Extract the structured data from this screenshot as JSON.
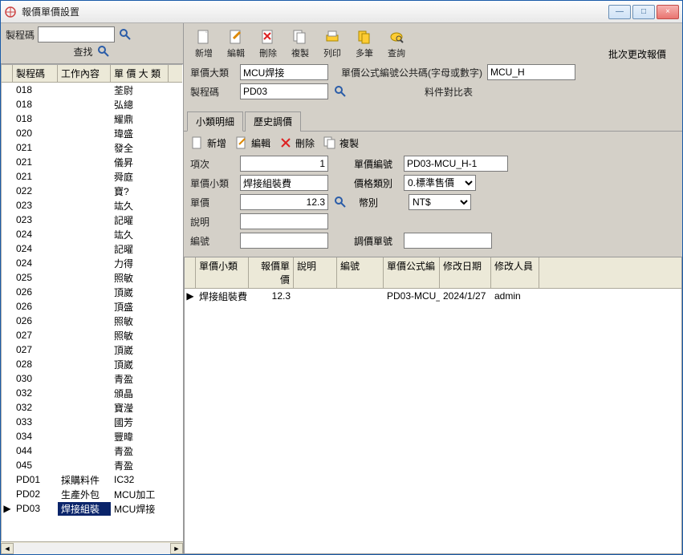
{
  "window": {
    "title": "報價單價設置"
  },
  "winbtns": {
    "min": "—",
    "max": "□",
    "close": "×"
  },
  "leftSearch": {
    "codeLabel": "製程碼",
    "codeValue": "",
    "findLabel": "查找"
  },
  "leftGrid": {
    "headers": {
      "code": "製程碼",
      "work": "工作內容",
      "cat": "單 價 大 類"
    },
    "rows": [
      {
        "code": "018",
        "work": "",
        "cat": "荃尉"
      },
      {
        "code": "018",
        "work": "",
        "cat": "弘總"
      },
      {
        "code": "018",
        "work": "",
        "cat": "耀鼎"
      },
      {
        "code": "020",
        "work": "",
        "cat": "瑋盛"
      },
      {
        "code": "021",
        "work": "",
        "cat": "發全"
      },
      {
        "code": "021",
        "work": "",
        "cat": "儀昇"
      },
      {
        "code": "021",
        "work": "",
        "cat": "舜庭"
      },
      {
        "code": "022",
        "work": "",
        "cat": "寶?"
      },
      {
        "code": "023",
        "work": "",
        "cat": "竑久"
      },
      {
        "code": "023",
        "work": "",
        "cat": "記曜"
      },
      {
        "code": "024",
        "work": "",
        "cat": "竑久"
      },
      {
        "code": "024",
        "work": "",
        "cat": "記曜"
      },
      {
        "code": "024",
        "work": "",
        "cat": "力得"
      },
      {
        "code": "025",
        "work": "",
        "cat": "照敏"
      },
      {
        "code": "026",
        "work": "",
        "cat": "頂崴"
      },
      {
        "code": "026",
        "work": "",
        "cat": "頂盛"
      },
      {
        "code": "026",
        "work": "",
        "cat": "照敏"
      },
      {
        "code": "027",
        "work": "",
        "cat": "照敏"
      },
      {
        "code": "027",
        "work": "",
        "cat": "頂崴"
      },
      {
        "code": "028",
        "work": "",
        "cat": "頂崴"
      },
      {
        "code": "030",
        "work": "",
        "cat": "青盈"
      },
      {
        "code": "032",
        "work": "",
        "cat": "頒晶"
      },
      {
        "code": "032",
        "work": "",
        "cat": "寶瀅"
      },
      {
        "code": "033",
        "work": "",
        "cat": "國芳"
      },
      {
        "code": "034",
        "work": "",
        "cat": "豐暐"
      },
      {
        "code": "044",
        "work": "",
        "cat": "青盈"
      },
      {
        "code": "045",
        "work": "",
        "cat": "青盈"
      },
      {
        "code": "PD01",
        "work": "採購料件",
        "cat": "IC32"
      },
      {
        "code": "PD02",
        "work": "生產外包",
        "cat": "MCU加工"
      },
      {
        "code": "PD03",
        "work": "焊接組裝",
        "cat": "MCU焊接",
        "selected": true
      }
    ]
  },
  "toolbar": {
    "add": "新增",
    "edit": "編輯",
    "del": "刪除",
    "copy": "複製",
    "print": "列印",
    "multi": "多筆",
    "query": "查詢",
    "batch": "批次更改報價"
  },
  "topForm": {
    "catLabel": "單價大類",
    "catValue": "MCU焊接",
    "formulaLabel": "單價公式編號公共碼(字母或數字)",
    "formulaValue": "MCU_H",
    "codeLabel": "製程碼",
    "codeValue": "PD03",
    "compareLabel": "料件對比表"
  },
  "tabs": {
    "detail": "小類明細",
    "history": "歷史調價"
  },
  "subtoolbar": {
    "add": "新增",
    "edit": "編輯",
    "del": "刪除",
    "copy": "複製"
  },
  "detailForm": {
    "seqLabel": "項次",
    "seqValue": "1",
    "noLabel": "單價編號",
    "noValue": "PD03-MCU_H-1",
    "subcatLabel": "單價小類",
    "subcatValue": "焊接組裝費",
    "pricetypeLabel": "價格類別",
    "pricetypeValue": "0.標準售價",
    "priceLabel": "單價",
    "priceValue": "12.3",
    "currencyLabel": "幣別",
    "currencyValue": "NT$",
    "descLabel": "說明",
    "descValue": "",
    "codeLabel": "編號",
    "codeValue": "",
    "adjnoLabel": "調價單號",
    "adjnoValue": ""
  },
  "detailGrid": {
    "headers": {
      "subcat": "單價小類",
      "price": "報價單價",
      "desc": "說明",
      "code": "編號",
      "formula": "單價公式編",
      "mdate": "修改日期",
      "muser": "修改人員"
    },
    "rows": [
      {
        "subcat": "焊接組裝費",
        "price": "12.3",
        "desc": "",
        "code": "",
        "formula": "PD03-MCU_",
        "mdate": "2024/1/27",
        "muser": "admin"
      }
    ]
  }
}
